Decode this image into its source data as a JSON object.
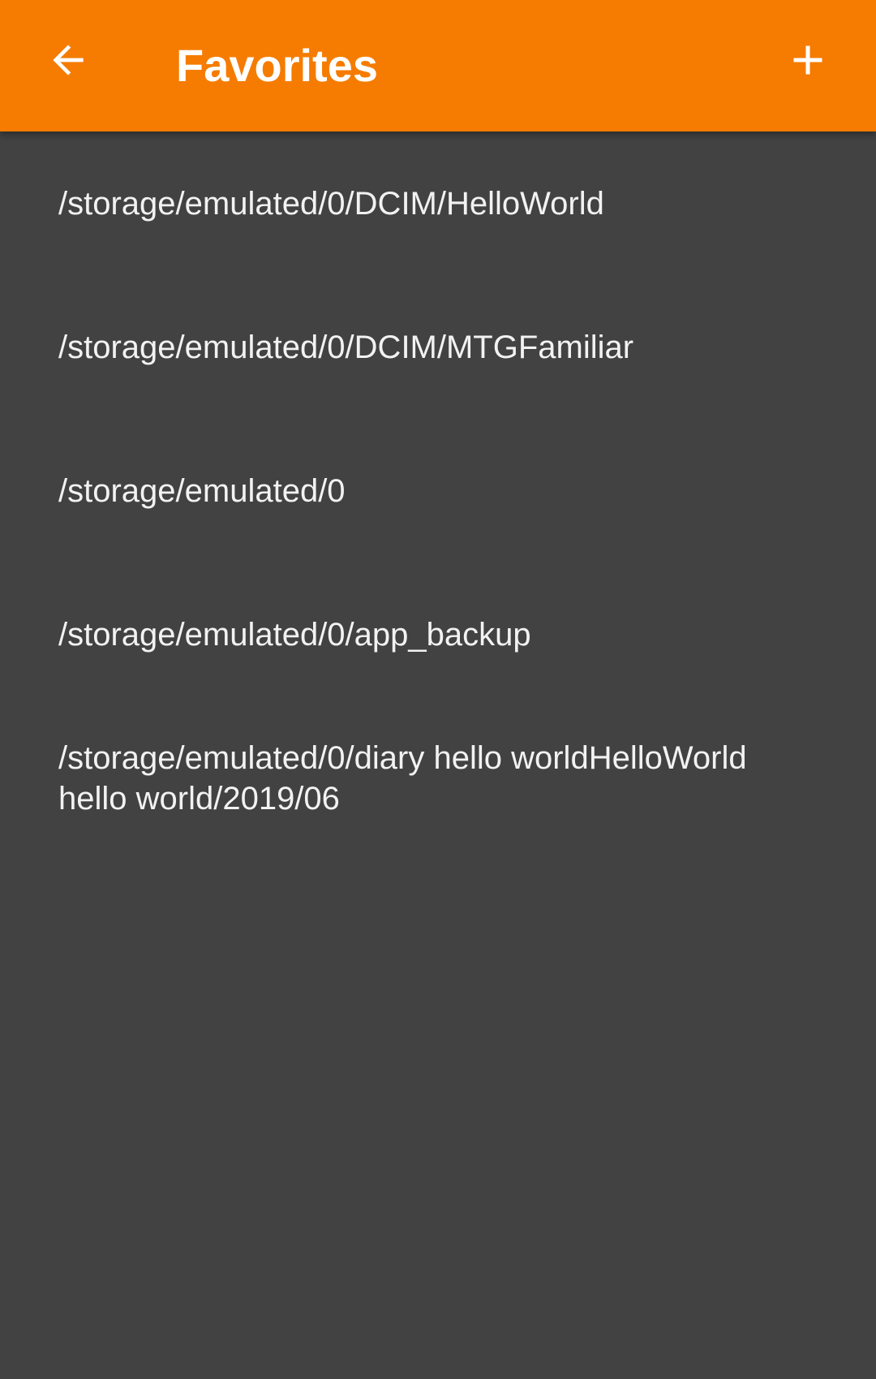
{
  "toolbar": {
    "title": "Favorites",
    "back_icon": "arrow-left-icon",
    "add_icon": "plus-icon",
    "background_color": "#F57C00"
  },
  "favorites": [
    {
      "path": "/storage/emulated/0/DCIM/HelloWorld"
    },
    {
      "path": "/storage/emulated/0/DCIM/MTGFamiliar"
    },
    {
      "path": "/storage/emulated/0"
    },
    {
      "path": "/storage/emulated/0/app_backup"
    },
    {
      "path": "/storage/emulated/0/diary hello worldHelloWorld hello world/2019/06"
    }
  ],
  "theme": {
    "background": "#424242",
    "text": "#F2F2F2"
  }
}
